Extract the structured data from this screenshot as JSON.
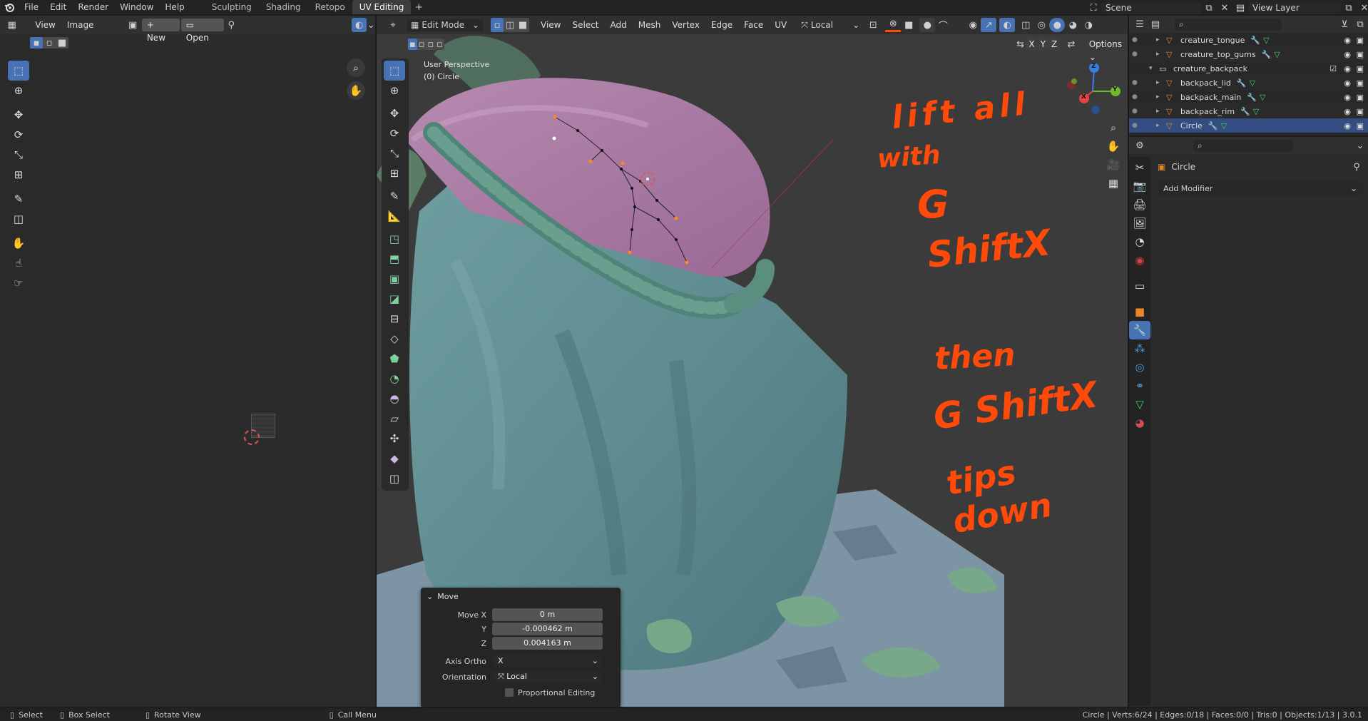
{
  "topbar": {
    "menus": [
      "File",
      "Edit",
      "Render",
      "Window",
      "Help"
    ],
    "workspaces": [
      "Sculpting",
      "Shading",
      "Retopo",
      "UV Editing"
    ],
    "active_workspace": "UV Editing",
    "scene": "Scene",
    "view_layer": "View Layer"
  },
  "uv_editor": {
    "menus": [
      "View",
      "Image"
    ],
    "new_label": "New",
    "open_label": "Open"
  },
  "viewport": {
    "mode": "Edit Mode",
    "menus": [
      "View",
      "Select",
      "Add",
      "Mesh",
      "Vertex",
      "Edge",
      "Face",
      "UV"
    ],
    "transform_orientation": "Local",
    "options_label": "Options",
    "axes": [
      "X",
      "Y",
      "Z"
    ],
    "info_line1": "User Perspective",
    "info_line2": "(0) Circle",
    "gizmo_axes": {
      "z": "Z",
      "y": "Y",
      "x": "X"
    }
  },
  "outliner": {
    "items": [
      {
        "name": "creature_tongue",
        "indent": 2,
        "type": "mesh"
      },
      {
        "name": "creature_top_gums",
        "indent": 2,
        "type": "mesh"
      },
      {
        "name": "creature_backpack",
        "indent": 1,
        "type": "collection"
      },
      {
        "name": "backpack_lid",
        "indent": 2,
        "type": "mesh"
      },
      {
        "name": "backpack_main",
        "indent": 2,
        "type": "mesh"
      },
      {
        "name": "backpack_rim",
        "indent": 2,
        "type": "mesh"
      },
      {
        "name": "Circle",
        "indent": 2,
        "type": "mesh",
        "selected": true
      }
    ]
  },
  "properties": {
    "object_name": "Circle",
    "add_modifier_label": "Add Modifier"
  },
  "redo_panel": {
    "title": "Move",
    "fields": [
      {
        "label": "Move X",
        "value": "0 m"
      },
      {
        "label": "Y",
        "value": "-0.000462 m"
      },
      {
        "label": "Z",
        "value": "0.004163 m"
      }
    ],
    "axis_ortho_label": "Axis Ortho",
    "axis_ortho_value": "X",
    "orientation_label": "Orientation",
    "orientation_value": "Local",
    "proportional_label": "Proportional Editing"
  },
  "annotations": {
    "line1": "lift all",
    "line2": "with",
    "line3": "G",
    "line4": "ShiftX",
    "line5": "then",
    "line6": "G ShiftX",
    "line7": "tips  down"
  },
  "statusbar": {
    "select": "Select",
    "box_select": "Box Select",
    "rotate_view": "Rotate View",
    "call_menu": "Call Menu",
    "stats": "Circle | Verts:6/24 | Edges:0/18 | Faces:0/0 | Tris:0 | Objects:1/13 | 3.0.1"
  },
  "colors": {
    "accent": "#4772b3",
    "annotation": "#ff4a0a",
    "selected_row": "#334d80"
  }
}
